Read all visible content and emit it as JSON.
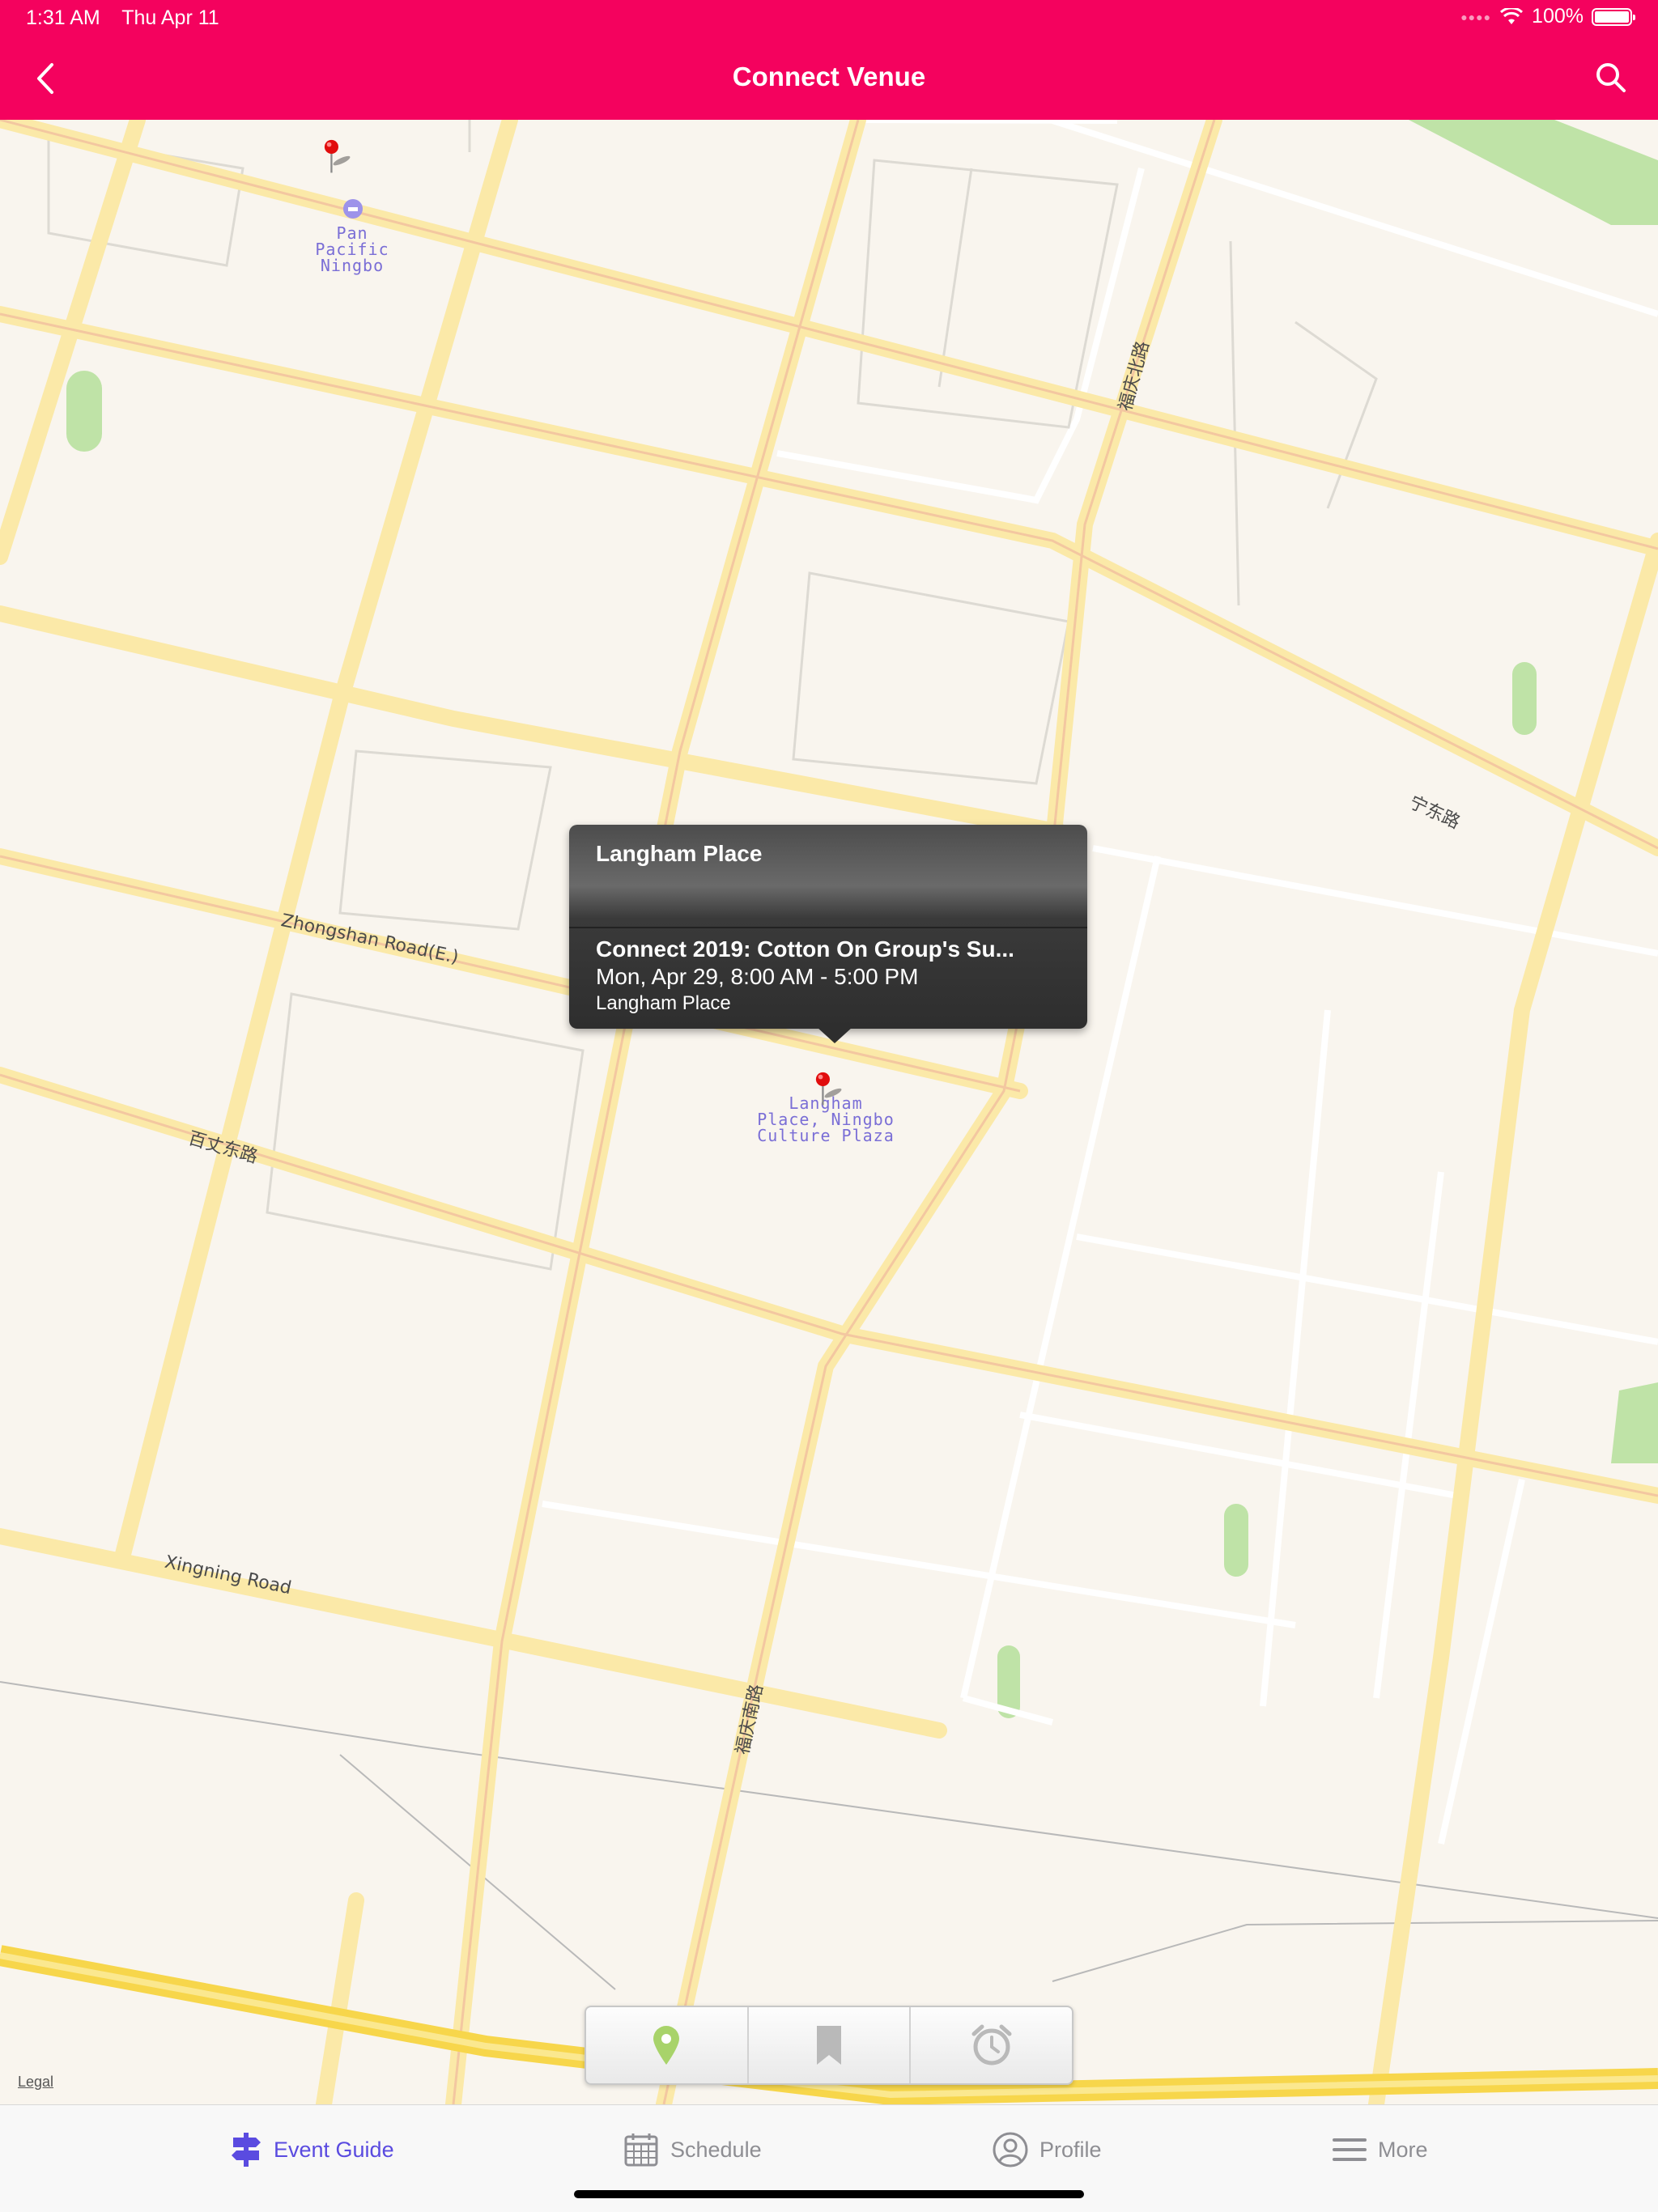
{
  "status_bar": {
    "time": "1:31 AM",
    "date": "Thu Apr 11",
    "battery": "100%"
  },
  "header": {
    "title": "Connect Venue",
    "back_icon": "chevron-left-icon",
    "search_icon": "search-icon"
  },
  "map": {
    "street_labels": [
      "Zhongshan Road(E.)",
      "百丈东路",
      "Xingning Road",
      "福庆北路",
      "福庆南路",
      "宁东路"
    ],
    "pois": [
      {
        "name": "Pan Pacific\nNingbo",
        "icon": "hotel-icon"
      },
      {
        "name": "Langham\nPlace, Ningbo\nCulture Plaza",
        "icon": "poi-icon"
      }
    ],
    "legal": "Legal"
  },
  "callout": {
    "venue": "Langham Place",
    "event_title": "Connect 2019: Cotton On Group's Su...",
    "event_time": "Mon, Apr 29, 8:00 AM - 5:00 PM",
    "event_location": "Langham Place"
  },
  "map_controls": [
    {
      "icon": "map-pin-icon",
      "active": true
    },
    {
      "icon": "bookmark-icon",
      "active": false
    },
    {
      "icon": "alarm-clock-icon",
      "active": false
    }
  ],
  "tab_bar": [
    {
      "label": "Event Guide",
      "icon": "signpost-icon",
      "active": true
    },
    {
      "label": "Schedule",
      "icon": "calendar-icon",
      "active": false
    },
    {
      "label": "Profile",
      "icon": "person-icon",
      "active": false
    },
    {
      "label": "More",
      "icon": "menu-icon",
      "active": false
    }
  ],
  "colors": {
    "header": "#f4025e",
    "active_tab": "#5a4be0",
    "map_bg": "#f9f5ee",
    "road": "#fbe9a8"
  }
}
